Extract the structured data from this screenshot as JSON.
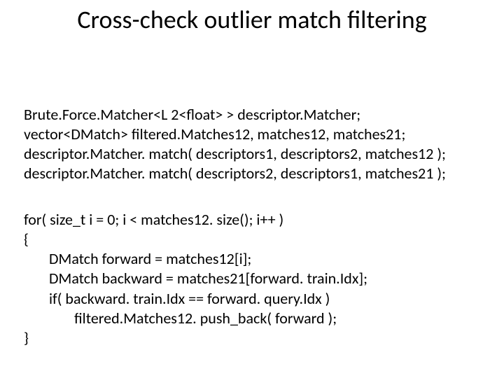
{
  "title": "Cross-check outlier match filtering",
  "block1": {
    "l1": "Brute.Force.Matcher<L 2<float> > descriptor.Matcher;",
    "l2": "vector<DMatch> filtered.Matches12, matches12, matches21;",
    "l3": "descriptor.Matcher. match( descriptors1, descriptors2, matches12 );",
    "l4": "descriptor.Matcher. match( descriptors2, descriptors1, matches21 );"
  },
  "block2": {
    "l1": "for( size_t i = 0; i < matches12. size(); i++ )",
    "l2": "{",
    "l3": "DMatch forward = matches12[i];",
    "l4": "DMatch backward = matches21[forward. train.Idx];",
    "l5": "if( backward. train.Idx == forward. query.Idx )",
    "l6": "filtered.Matches12. push_back( forward );",
    "l7": "}"
  }
}
